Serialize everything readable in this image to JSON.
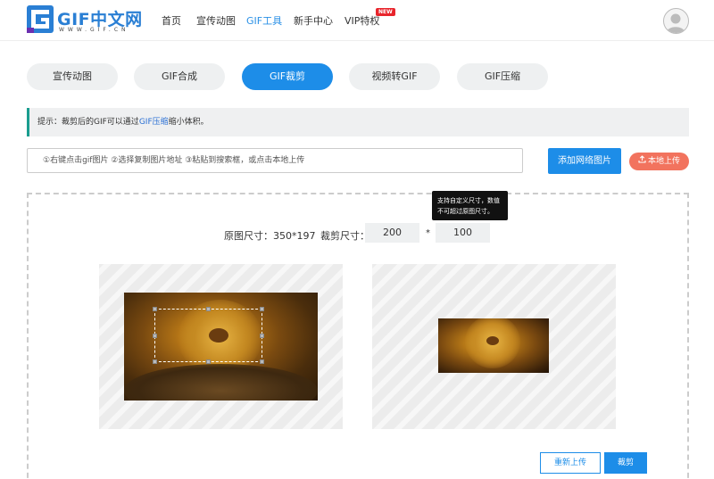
{
  "header": {
    "logo_text": "GIF中文网",
    "logo_sub": "WWW.GIF.CN",
    "nav": [
      "首页",
      "宣传动图",
      "GIF工具",
      "新手中心",
      "VIP特权"
    ],
    "nav_active_index": 2,
    "new_badge": "NEW"
  },
  "tabs": [
    "宣传动图",
    "GIF合成",
    "GIF裁剪",
    "视频转GIF",
    "GIF压缩"
  ],
  "tab_active_index": 2,
  "tip": {
    "prefix": "提示：裁剪后的GIF可以通过",
    "link": "GIF压缩",
    "suffix": "缩小体积。"
  },
  "search": {
    "placeholder": "①右键点击gif图片 ②选择复制图片地址 ③粘贴到搜索框，或点击本地上传"
  },
  "buttons": {
    "add_network": "添加网络图片",
    "local_upload": "本地上传",
    "reupload": "重新上传",
    "crop": "裁剪"
  },
  "crop": {
    "original_label": "原图尺寸：350*197",
    "crop_label": "裁剪尺寸：",
    "width": "200",
    "times": "*",
    "height": "100",
    "tooltip_line1": "支持自定义尺寸，数值",
    "tooltip_line2": "不可超过原图尺寸。"
  },
  "colors": {
    "accent": "#1d8de8",
    "upload": "#f2735e",
    "tip_bar": "#1a9d8f"
  }
}
